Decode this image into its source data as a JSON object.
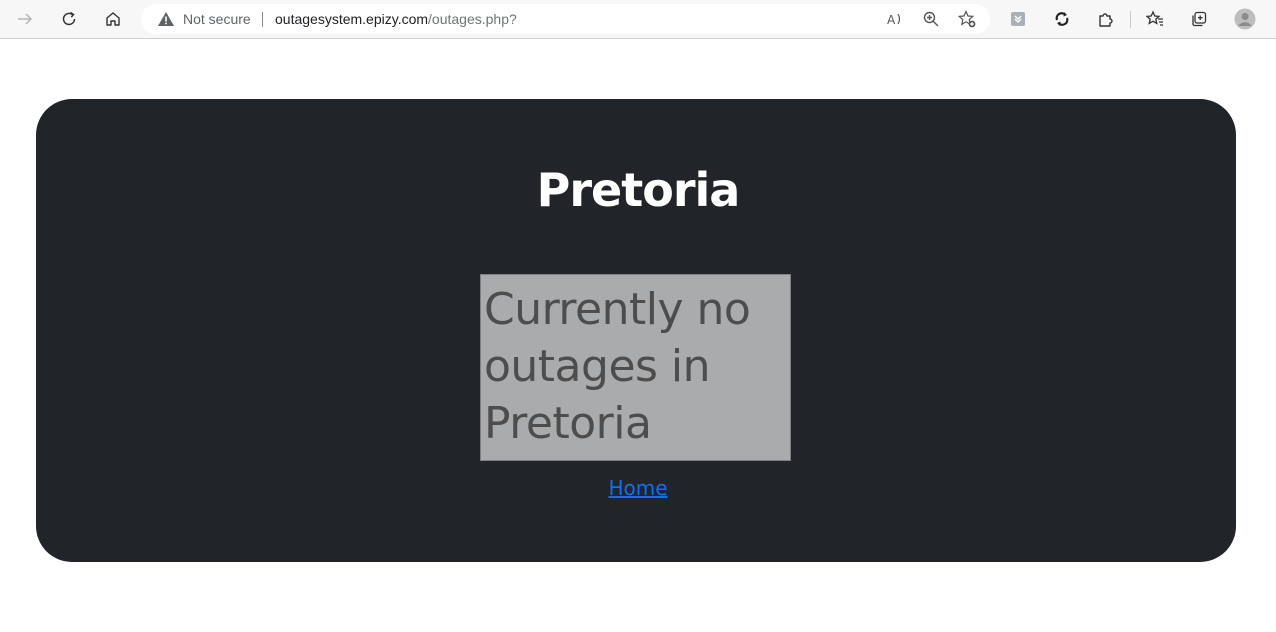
{
  "browser": {
    "security_status": "Not secure",
    "url_host": "outagesystem.epizy.com",
    "url_path": "/outages.php?",
    "buttons": {
      "back": "arrow-right-icon",
      "refresh": "refresh-icon",
      "home": "home-icon",
      "read_aloud": "read-aloud-icon",
      "zoom": "zoom-icon",
      "add_favorite": "add-favorite-icon",
      "extension_a": "shield-extension-icon",
      "extension_b": "sync-extension-icon",
      "extensions": "puzzle-icon",
      "favorites": "favorites-icon",
      "collections": "collections-icon",
      "profile": "profile-icon"
    }
  },
  "page": {
    "city_title": "Pretoria",
    "notice": "Currently no outages in Pretoria",
    "home_link": "Home"
  },
  "colors": {
    "card_background": "#212529",
    "notice_background": "#a9abad",
    "notice_text": "#4d4d4d",
    "link": "#0d6efd",
    "title_text": "#ffffff"
  }
}
